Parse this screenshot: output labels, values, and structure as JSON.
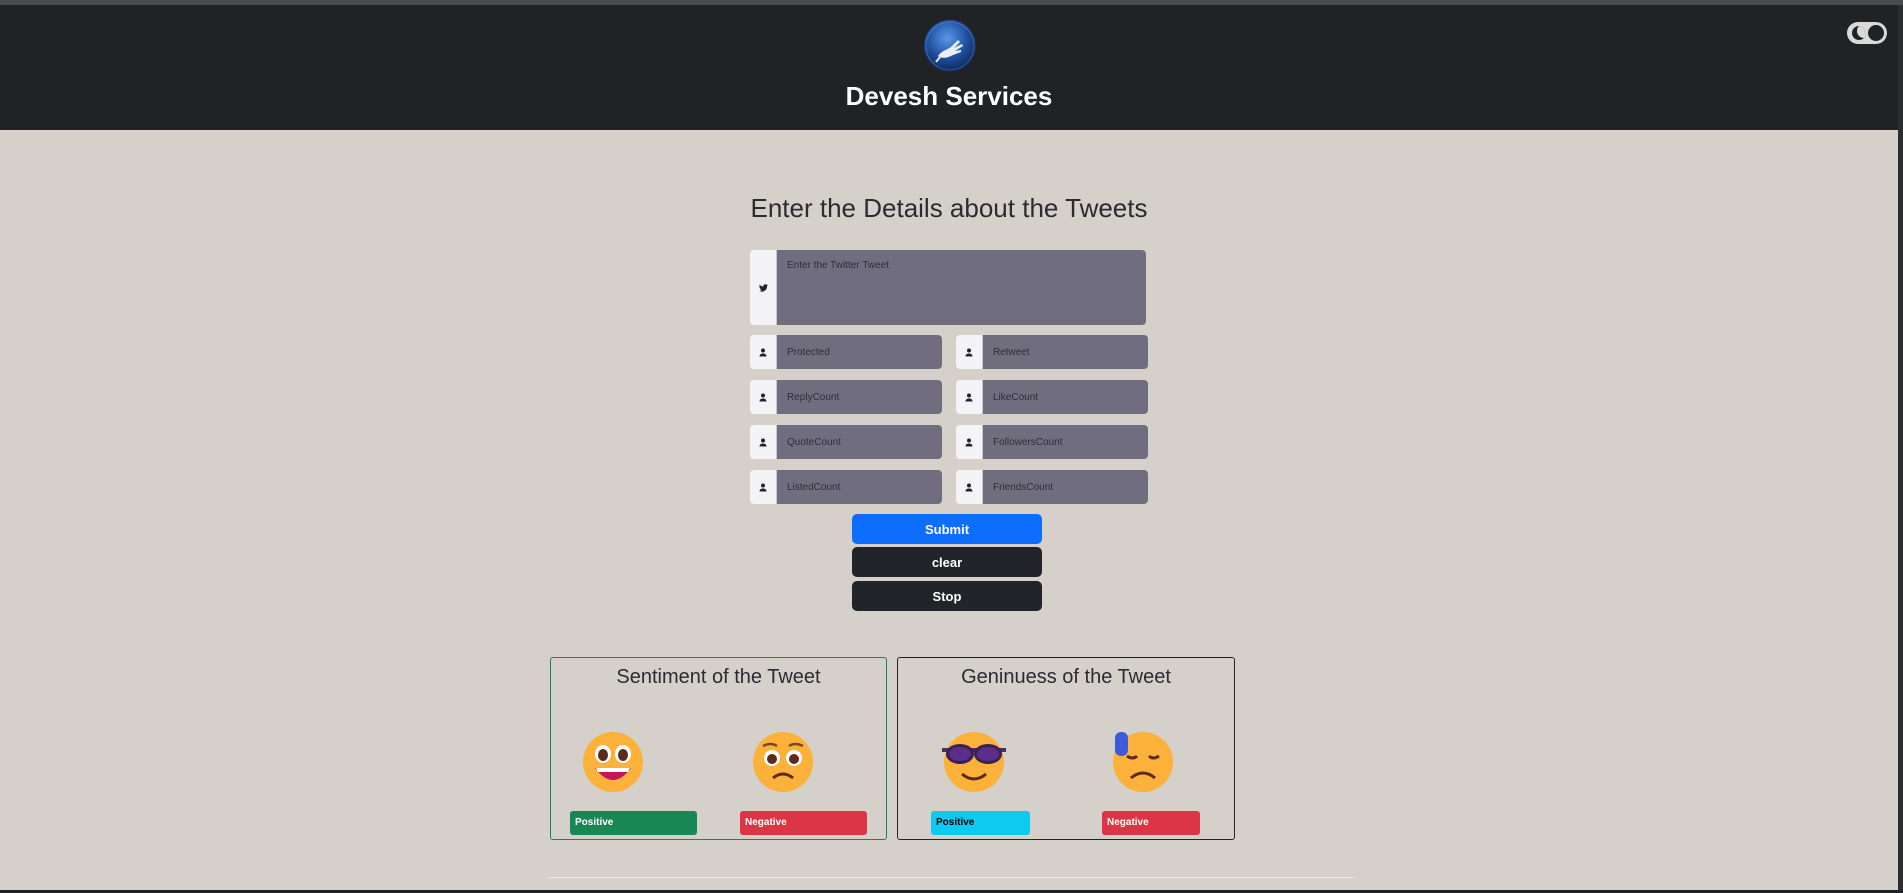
{
  "header": {
    "brand": "Devesh Services",
    "logo_icon": "globe-hand-logo",
    "theme_toggle_icon": "moon-icon"
  },
  "form": {
    "heading": "Enter the Details about the Tweets",
    "tweet_placeholder": "Enter the Twitter Tweet",
    "tweet_icon": "twitter-icon",
    "fields": [
      {
        "placeholder": "Protected",
        "icon": "person-icon"
      },
      {
        "placeholder": "Retweet",
        "icon": "person-icon"
      },
      {
        "placeholder": "ReplyCount",
        "icon": "person-icon"
      },
      {
        "placeholder": "LikeCount",
        "icon": "person-icon"
      },
      {
        "placeholder": "QuoteCount",
        "icon": "person-icon"
      },
      {
        "placeholder": "FollowersCount",
        "icon": "person-icon"
      },
      {
        "placeholder": "ListedCount",
        "icon": "person-icon"
      },
      {
        "placeholder": "FriendsCount",
        "icon": "person-icon"
      }
    ],
    "submit_label": "Submit",
    "clear_label": "clear",
    "stop_label": "Stop"
  },
  "sentiment": {
    "title": "Sentiment of the Tweet",
    "positive_label": "Positive",
    "negative_label": "Negative",
    "positive_icon": "grinning-face-icon",
    "negative_icon": "pleading-face-icon"
  },
  "genuineness": {
    "title": "Geninuess of the Tweet",
    "positive_label": "Positive",
    "negative_label": "Negative",
    "positive_icon": "sunglasses-face-icon",
    "negative_icon": "sweat-face-icon"
  },
  "colors": {
    "header_bg": "#212225",
    "page_bg": "#d5d0ca",
    "submit": "#0d6efd",
    "dark_button": "#212529",
    "success": "#198754",
    "danger": "#dc3545",
    "info": "#0dcaf0"
  }
}
